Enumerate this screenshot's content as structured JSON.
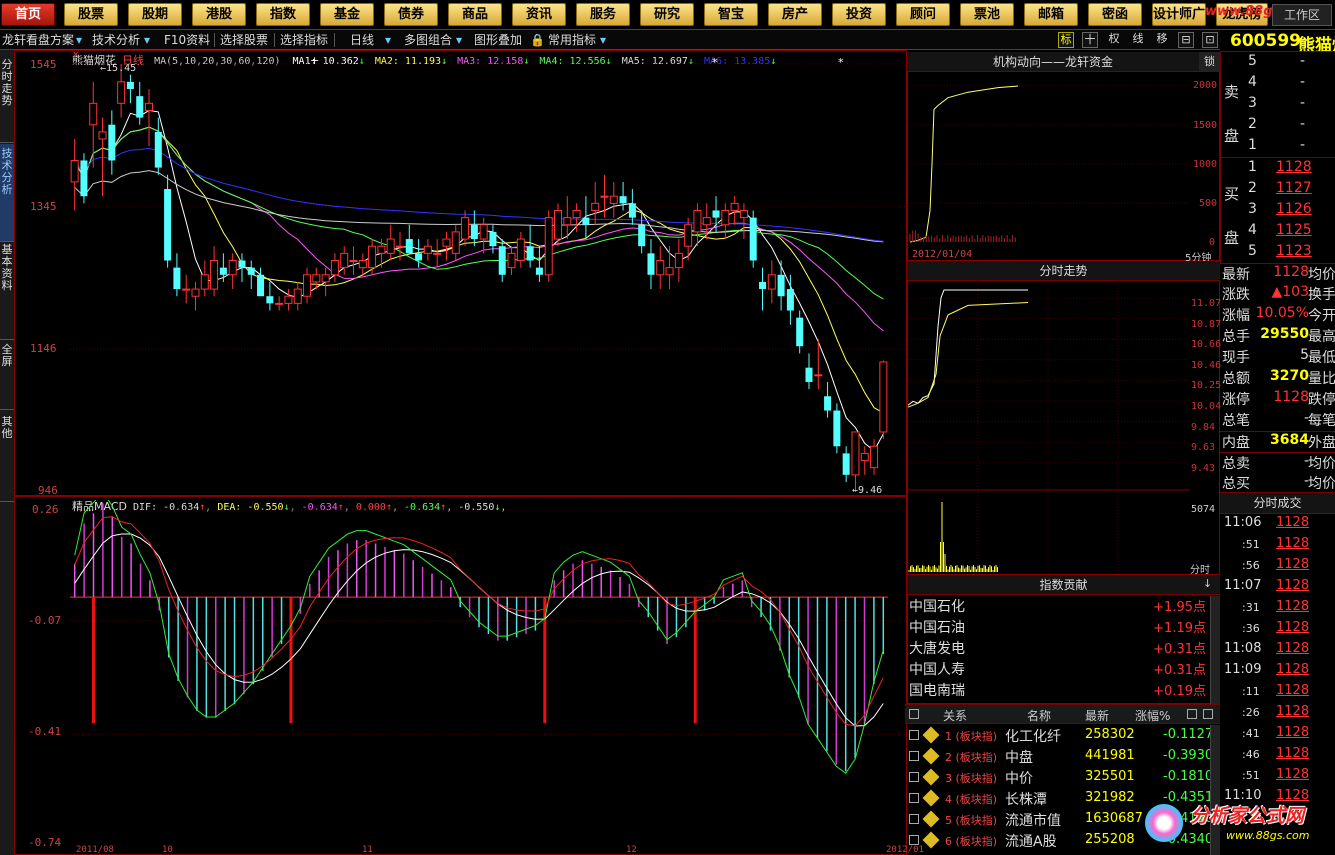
{
  "topnav": {
    "items": [
      "首页",
      "股票",
      "股期",
      "港股",
      "指数",
      "基金",
      "债券",
      "商品",
      "资讯",
      "服务",
      "研究",
      "智宝",
      "房产",
      "投资",
      "顾问",
      "票池",
      "邮箱",
      "密函",
      "设计师广",
      "龙虎榜"
    ],
    "watermark": "www.88gs.com",
    "workarea": "工作区"
  },
  "toolbar": {
    "scheme": "龙轩看盘方案",
    "tech": "技术分析",
    "f10": "F10资料",
    "select_stock": "选择股票",
    "select_indicator": "选择指标",
    "period": "日线",
    "multi": "多图组合",
    "overlay": "图形叠加",
    "common": "常用指标",
    "right_tools": [
      "标",
      "十",
      "权",
      "线",
      "移",
      "⊟",
      "⊡"
    ]
  },
  "left_tabs": [
    "分时走势",
    "技术分析",
    "基本资料",
    "全屏",
    "其他"
  ],
  "stock": {
    "code": "600599",
    "name": "熊猫烟花"
  },
  "kchart": {
    "name": "熊猫烟花",
    "period_tag": "日线",
    "ma_params": "MA(5,10,20,30,60,120)",
    "ma_values": [
      {
        "label": "MA1: 10.362",
        "color": "#ffffff"
      },
      {
        "label": "MA2: 11.193",
        "color": "#ffff55"
      },
      {
        "label": "MA3: 12.158",
        "color": "#ff55ff"
      },
      {
        "label": "MA4: 12.556",
        "color": "#55ff55"
      },
      {
        "label": "MA5: 12.697",
        "color": "#dddddd"
      },
      {
        "label": "MA6: 13.385",
        "color": "#3333ff"
      }
    ],
    "y_ticks": [
      "1545",
      "1345",
      "1146",
      "946"
    ],
    "high_label": "15.45",
    "low_label": "9.46",
    "ohlc": [
      [
        13.8,
        14.4,
        13.4,
        14.1
      ],
      [
        14.1,
        14.2,
        13.5,
        13.6
      ],
      [
        14.6,
        15.2,
        14.0,
        14.9
      ],
      [
        14.4,
        14.7,
        13.6,
        14.5
      ],
      [
        14.6,
        14.8,
        13.9,
        14.1
      ],
      [
        14.9,
        15.45,
        14.7,
        15.2
      ],
      [
        15.2,
        15.3,
        14.9,
        15.1
      ],
      [
        15.0,
        15.2,
        14.6,
        14.7
      ],
      [
        14.8,
        15.1,
        14.3,
        14.9
      ],
      [
        14.5,
        14.7,
        13.9,
        14.0
      ],
      [
        13.7,
        13.9,
        12.6,
        12.7
      ],
      [
        12.6,
        12.8,
        12.2,
        12.3
      ],
      [
        12.3,
        12.5,
        12.1,
        12.3
      ],
      [
        12.2,
        12.4,
        12.0,
        12.3
      ],
      [
        12.3,
        12.7,
        12.2,
        12.5
      ],
      [
        12.3,
        12.9,
        12.2,
        12.7
      ],
      [
        12.6,
        12.8,
        12.4,
        12.5
      ],
      [
        12.5,
        12.8,
        12.3,
        12.7
      ],
      [
        12.7,
        12.8,
        12.4,
        12.6
      ],
      [
        12.6,
        12.7,
        12.3,
        12.5
      ],
      [
        12.5,
        12.6,
        12.2,
        12.2
      ],
      [
        12.2,
        12.4,
        12.0,
        12.1
      ],
      [
        12.1,
        12.2,
        12.0,
        12.1
      ],
      [
        12.1,
        12.3,
        12.0,
        12.2
      ],
      [
        12.1,
        12.4,
        12.0,
        12.3
      ],
      [
        12.2,
        12.6,
        12.1,
        12.5
      ],
      [
        12.4,
        12.6,
        12.3,
        12.5
      ],
      [
        12.4,
        12.6,
        12.2,
        12.5
      ],
      [
        12.5,
        12.8,
        12.4,
        12.7
      ],
      [
        12.6,
        12.9,
        12.5,
        12.8
      ],
      [
        12.7,
        12.9,
        12.5,
        12.7
      ],
      [
        12.6,
        12.8,
        12.5,
        12.7
      ],
      [
        12.6,
        13.0,
        12.5,
        12.9
      ],
      [
        12.8,
        13.0,
        12.6,
        12.9
      ],
      [
        12.8,
        13.2,
        12.7,
        13.0
      ],
      [
        12.9,
        13.1,
        12.7,
        12.9
      ],
      [
        13.0,
        13.2,
        12.8,
        12.8
      ],
      [
        12.8,
        13.0,
        12.6,
        12.7
      ],
      [
        12.8,
        13.0,
        12.7,
        12.9
      ],
      [
        12.8,
        13.0,
        12.6,
        12.8
      ],
      [
        12.9,
        13.1,
        12.7,
        13.0
      ],
      [
        12.8,
        13.2,
        12.7,
        13.1
      ],
      [
        13.0,
        13.4,
        12.9,
        13.3
      ],
      [
        13.2,
        13.4,
        12.9,
        13.0
      ],
      [
        13.0,
        13.3,
        12.8,
        13.2
      ],
      [
        13.1,
        13.2,
        12.8,
        12.9
      ],
      [
        12.9,
        13.0,
        12.4,
        12.5
      ],
      [
        12.6,
        12.9,
        12.5,
        12.8
      ],
      [
        12.7,
        13.1,
        12.6,
        13.0
      ],
      [
        12.9,
        13.2,
        12.6,
        12.7
      ],
      [
        12.6,
        12.9,
        12.4,
        12.5
      ],
      [
        12.5,
        13.4,
        12.4,
        13.3
      ],
      [
        13.0,
        13.5,
        12.9,
        13.4
      ],
      [
        13.2,
        13.6,
        13.0,
        13.3
      ],
      [
        13.3,
        13.5,
        13.1,
        13.4
      ],
      [
        13.3,
        13.6,
        13.0,
        13.2
      ],
      [
        13.4,
        13.8,
        13.2,
        13.5
      ],
      [
        13.6,
        13.9,
        13.3,
        13.6
      ],
      [
        13.5,
        13.8,
        13.3,
        13.6
      ],
      [
        13.6,
        13.8,
        13.4,
        13.5
      ],
      [
        13.5,
        13.7,
        13.2,
        13.3
      ],
      [
        13.2,
        13.4,
        12.8,
        12.9
      ],
      [
        12.8,
        13.0,
        12.3,
        12.5
      ],
      [
        12.5,
        12.9,
        12.3,
        12.7
      ],
      [
        12.5,
        12.9,
        12.3,
        12.6
      ],
      [
        12.6,
        13.0,
        12.4,
        12.8
      ],
      [
        12.9,
        13.3,
        12.7,
        13.2
      ],
      [
        13.1,
        13.5,
        12.9,
        13.4
      ],
      [
        13.2,
        13.5,
        13.0,
        13.3
      ],
      [
        13.4,
        13.6,
        13.1,
        13.3
      ],
      [
        13.2,
        13.5,
        13.0,
        13.4
      ],
      [
        13.4,
        13.6,
        13.2,
        13.5
      ],
      [
        13.3,
        13.5,
        13.0,
        13.4
      ],
      [
        13.3,
        13.4,
        12.6,
        12.7
      ],
      [
        12.4,
        12.6,
        12.0,
        12.3
      ],
      [
        12.3,
        12.7,
        12.1,
        12.5
      ],
      [
        12.5,
        12.7,
        12.0,
        12.2
      ],
      [
        12.3,
        12.5,
        11.8,
        12.0
      ],
      [
        11.9,
        12.0,
        11.4,
        11.5
      ],
      [
        11.2,
        11.4,
        10.9,
        11.0
      ],
      [
        11.1,
        11.6,
        10.9,
        11.1
      ],
      [
        10.8,
        11.0,
        10.5,
        10.6
      ],
      [
        10.6,
        10.7,
        10.0,
        10.1
      ],
      [
        10.0,
        10.1,
        9.6,
        9.7
      ],
      [
        9.7,
        10.3,
        9.46,
        10.3
      ],
      [
        9.9,
        10.1,
        9.7,
        10.0
      ],
      [
        9.8,
        10.2,
        9.7,
        10.1
      ],
      [
        10.3,
        11.3,
        10.2,
        11.28
      ]
    ]
  },
  "macd": {
    "label": "精品MACD",
    "dif": "DIF: -0.634",
    "dea": "DEA: -0.550",
    "v1": "-0.634",
    "v2": "0.000",
    "v3": "-0.634",
    "v4": "-0.550",
    "y_ticks": [
      "0.26",
      "-0.07",
      "-0.41",
      "-0.74"
    ],
    "bars": [
      0.1,
      0.22,
      0.25,
      0.28,
      0.24,
      0.18,
      0.16,
      0.1,
      0.05,
      -0.04,
      -0.18,
      -0.25,
      -0.3,
      -0.34,
      -0.36,
      -0.36,
      -0.34,
      -0.32,
      -0.29,
      -0.26,
      -0.22,
      -0.18,
      -0.14,
      -0.1,
      -0.05,
      0.04,
      0.08,
      0.12,
      0.14,
      0.16,
      0.17,
      0.17,
      0.16,
      0.15,
      0.14,
      0.13,
      0.11,
      0.09,
      0.07,
      0.05,
      0.03,
      -0.03,
      -0.06,
      -0.09,
      -0.11,
      -0.13,
      -0.13,
      -0.12,
      -0.11,
      -0.1,
      -0.08,
      0.05,
      0.08,
      0.1,
      0.11,
      0.1,
      0.09,
      0.08,
      0.06,
      0.04,
      -0.03,
      -0.06,
      -0.1,
      -0.14,
      -0.12,
      -0.09,
      -0.06,
      -0.04,
      -0.02,
      0.03,
      0.04,
      0.05,
      -0.03,
      -0.06,
      -0.1,
      -0.16,
      -0.24,
      -0.3,
      -0.38,
      -0.42,
      -0.46,
      -0.5,
      -0.52,
      -0.48,
      -0.38,
      -0.26,
      -0.17
    ]
  },
  "fund_panel": {
    "title": "机构动向——龙轩资金",
    "scale": [
      "2000",
      "1500",
      "1000",
      "500",
      "0"
    ],
    "date": "2012/01/04",
    "period": "5分钟",
    "lock": "锁"
  },
  "intraday": {
    "title": "分时走势",
    "y_labels": [
      "11.07",
      "10.87",
      "10.66",
      "10.46",
      "10.25",
      "10.04",
      "9.84",
      "9.63",
      "9.43"
    ],
    "vol_top": "5074",
    "vol_unit": "分时"
  },
  "contrib": {
    "title": "指数贡献",
    "rows": [
      {
        "name": "中国石化",
        "val": "+1.95点"
      },
      {
        "name": "中国石油",
        "val": "+1.19点"
      },
      {
        "name": "大唐发电",
        "val": "+0.31点"
      },
      {
        "name": "中国人寿",
        "val": "+0.31点"
      },
      {
        "name": "国电南瑞",
        "val": "+0.19点"
      }
    ]
  },
  "block": {
    "headers": [
      "关系",
      "名称",
      "最新",
      "涨幅%"
    ],
    "rows": [
      {
        "rel": "1 (板块指)",
        "name": "化工化纤",
        "last": "258302",
        "chg": "-0.1127"
      },
      {
        "rel": "2 (板块指)",
        "name": "中盘",
        "last": "441981",
        "chg": "-0.3930"
      },
      {
        "rel": "3 (板块指)",
        "name": "中价",
        "last": "325501",
        "chg": "-0.1810"
      },
      {
        "rel": "4 (板块指)",
        "name": "长株潭",
        "last": "321982",
        "chg": "-0.4351"
      },
      {
        "rel": "5 (板块指)",
        "name": "流通市值",
        "last": "1630687",
        "chg": "-0.4140"
      },
      {
        "rel": "6 (板块指)",
        "name": "流通A股",
        "last": "255208",
        "chg": "-0.4340"
      }
    ]
  },
  "orderbook": {
    "sell_label": [
      "卖",
      "盘"
    ],
    "buy_label": [
      "买",
      "盘"
    ],
    "sell": [
      {
        "n": "5",
        "p": "-"
      },
      {
        "n": "4",
        "p": "-"
      },
      {
        "n": "3",
        "p": "-"
      },
      {
        "n": "2",
        "p": "-"
      },
      {
        "n": "1",
        "p": "-"
      }
    ],
    "buy": [
      {
        "n": "1",
        "p": "1128"
      },
      {
        "n": "2",
        "p": "1127"
      },
      {
        "n": "3",
        "p": "1126"
      },
      {
        "n": "4",
        "p": "1125"
      },
      {
        "n": "5",
        "p": "1123"
      }
    ]
  },
  "quote": [
    {
      "k": "最新",
      "v": "1128",
      "k2": "均价"
    },
    {
      "k": "涨跌",
      "v": "▲103",
      "k2": "换手"
    },
    {
      "k": "涨幅",
      "v": "10.05%",
      "k2": "今开"
    },
    {
      "k": "总手",
      "v": "29550",
      "k2": "最高"
    },
    {
      "k": "现手",
      "v": "5",
      "k2": "最低"
    },
    {
      "k": "总额",
      "v": "3270",
      "k2": "量比"
    },
    {
      "k": "涨停",
      "v": "1128",
      "k2": "跌停"
    },
    {
      "k": "总笔",
      "v": "-",
      "k2": "每笔"
    },
    {
      "k": "内盘",
      "v": "3684",
      "k2": "外盘"
    },
    {
      "k": "总卖",
      "v": "-",
      "k2": "均价"
    },
    {
      "k": "总买",
      "v": "-",
      "k2": "均价"
    }
  ],
  "ticks_title": "分时成交",
  "ticks": [
    {
      "t": "11:06",
      "p": "1128"
    },
    {
      "t": ":51",
      "p": "1128"
    },
    {
      "t": ":56",
      "p": "1128"
    },
    {
      "t": "11:07",
      "p": "1128"
    },
    {
      "t": ":31",
      "p": "1128"
    },
    {
      "t": ":36",
      "p": "1128"
    },
    {
      "t": "11:08",
      "p": "1128"
    },
    {
      "t": "11:09",
      "p": "1128"
    },
    {
      "t": ":11",
      "p": "1128"
    },
    {
      "t": ":26",
      "p": "1128"
    },
    {
      "t": ":41",
      "p": "1128"
    },
    {
      "t": ":46",
      "p": "1128"
    },
    {
      "t": ":51",
      "p": "1128"
    },
    {
      "t": "11:10",
      "p": "1128"
    }
  ],
  "bottom_axis": [
    "2011/08",
    "10",
    "11",
    "12",
    "2012/01"
  ],
  "logo_text": "分析家公式网",
  "logo_url": "www.88gs.com"
}
